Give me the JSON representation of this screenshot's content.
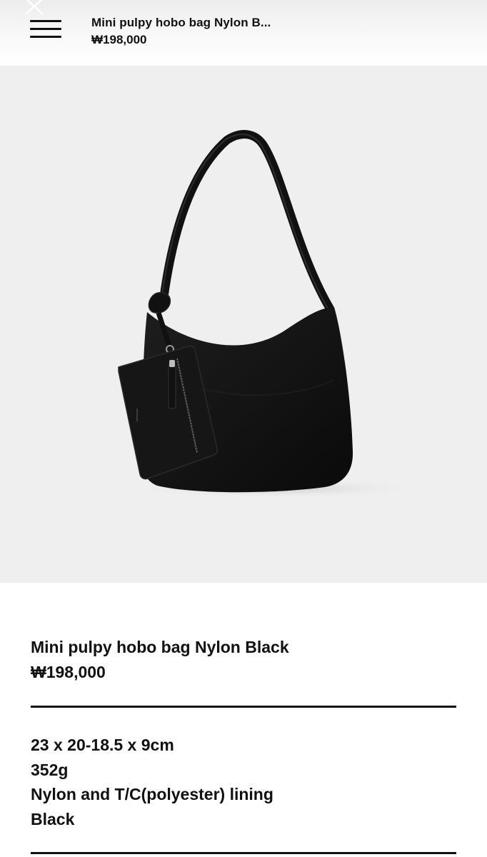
{
  "header": {
    "title": "Mini pulpy hobo bag Nylon B...",
    "price": "₩198,000",
    "close_icon": "close-icon",
    "menu_icon": "hamburger-menu-icon"
  },
  "product": {
    "name": "Mini pulpy hobo bag Nylon Black",
    "price": "₩198,000",
    "specs": {
      "dimensions": "23 x 20-18.5 x 9cm",
      "weight": "352g",
      "material": "Nylon and T/C(polyester) lining",
      "color": "Black"
    }
  },
  "colors": {
    "image_background": "#efefef",
    "bag": "#141414",
    "text": "#111111"
  }
}
